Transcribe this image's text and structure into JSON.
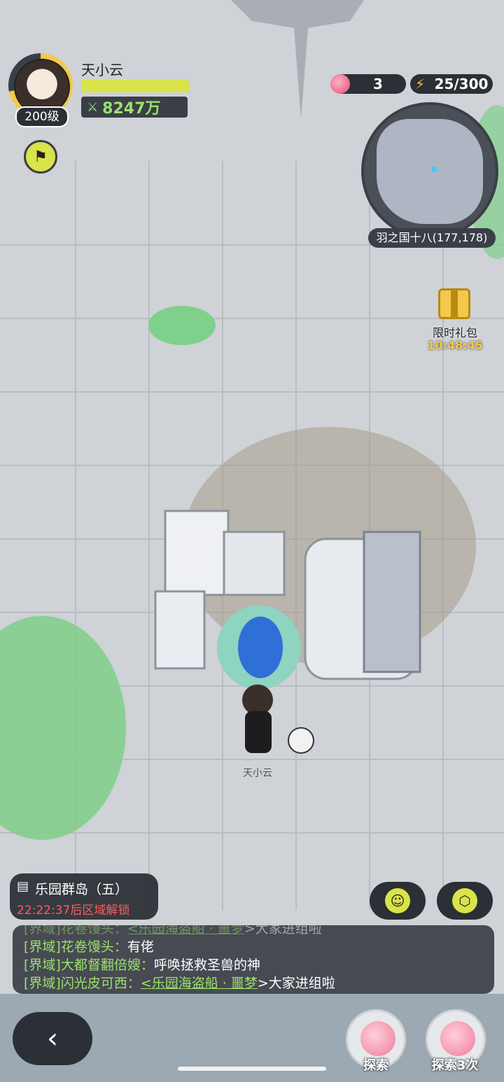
{
  "player": {
    "name": "天小云",
    "level": "200级",
    "power": "8247万",
    "hp_fill": 1.0
  },
  "resources": {
    "apples": "3",
    "energy": "25/300"
  },
  "minimap": {
    "location": "羽之国十八(177,178)"
  },
  "gift": {
    "label": "限时礼包",
    "timer": "10:48:45"
  },
  "character": {
    "name": "天小云"
  },
  "area": {
    "title": "乐园群岛（五）",
    "unlock": "22:22:37后区域解锁"
  },
  "chat": {
    "lines": [
      {
        "channel": "[界域]",
        "speaker": "花卷馒头：",
        "text": "<乐园海盗船 · 噩梦",
        "suffix": ">大家进组啦"
      },
      {
        "channel": "[界域]",
        "speaker": "花卷馒头：",
        "text": "有佬"
      },
      {
        "channel": "[界域]",
        "speaker": "大都督翻倍嫂：",
        "text": "呼唤拯救圣兽的神"
      },
      {
        "channel": "[界域]",
        "speaker": "闪光皮可西：",
        "text": "<乐园海盗船 · 噩梦",
        "suffix": ">大家进组啦"
      }
    ]
  },
  "actions": {
    "explore": "探索",
    "explore3": "探索3次"
  },
  "colors": {
    "accent": "#d9e34a",
    "power": "#9be26b",
    "warning": "#ff5b5b",
    "panel": "#2b2f36"
  },
  "icons": {
    "energy": "lightning-icon",
    "apple": "apple-icon",
    "flag": "flag-icon",
    "back": "chevron-left-icon"
  }
}
